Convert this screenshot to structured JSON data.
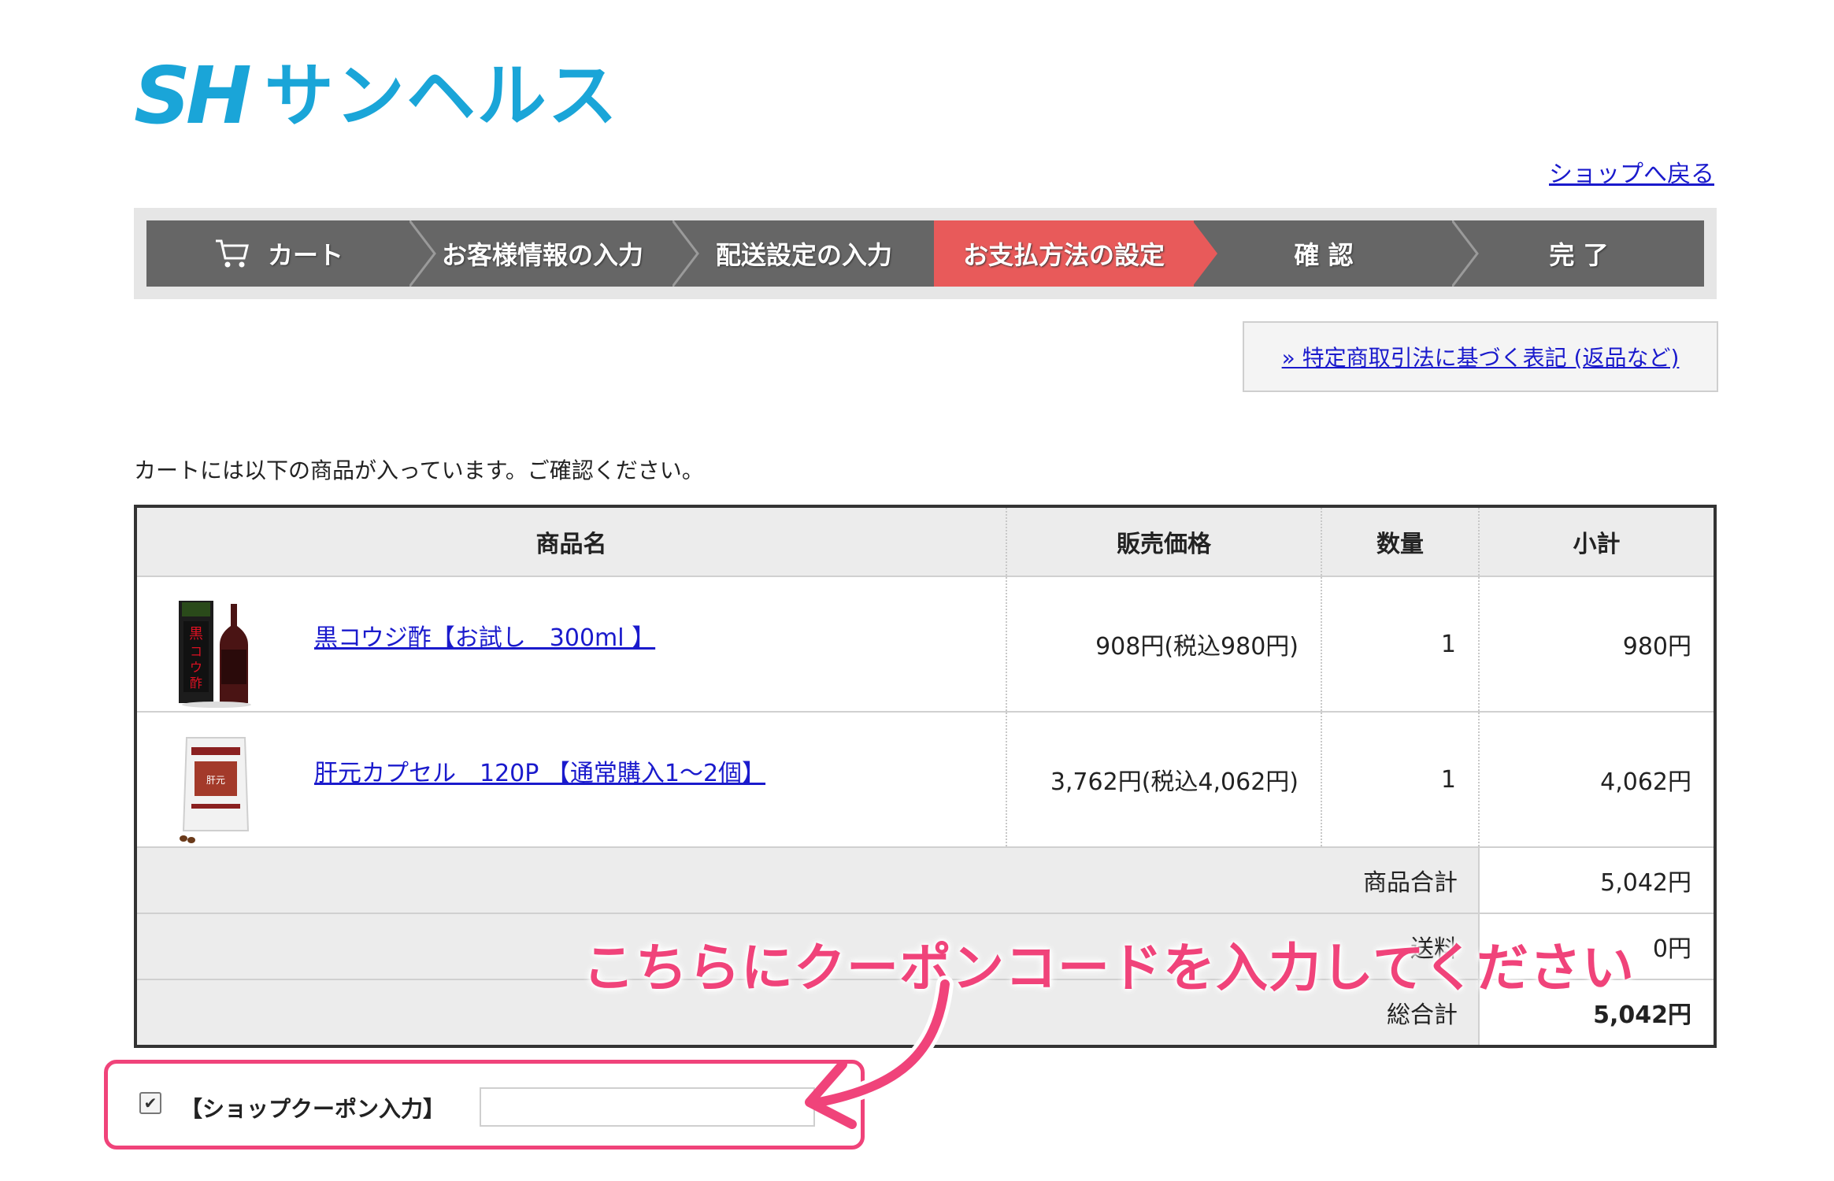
{
  "logo": {
    "mark": "SH",
    "name": "サンヘルス",
    "brand_color": "#1aa5d8"
  },
  "back_link": "ショップへ戻る",
  "steps": [
    {
      "label": "カート",
      "active": false
    },
    {
      "label": "お客様情報の入力",
      "active": false
    },
    {
      "label": "配送設定の入力",
      "active": false
    },
    {
      "label": "お支払方法の設定",
      "active": true
    },
    {
      "label": "確 認",
      "active": false
    },
    {
      "label": "完 了",
      "active": false
    }
  ],
  "law_link": "» 特定商取引法に基づく表記 (返品など)",
  "intro": "カートには以下の商品が入っています。ご確認ください。",
  "table": {
    "headers": [
      "商品名",
      "販売価格",
      "数量",
      "小計"
    ],
    "rows": [
      {
        "name": "黒コウジ酢【お試し　300ml 】",
        "price": "908円(税込980円)",
        "qty": "1",
        "subtotal": "980円"
      },
      {
        "name": "肝元カプセル　120P 【通常購入1～2個】",
        "price": "3,762円(税込4,062円)",
        "qty": "1",
        "subtotal": "4,062円"
      }
    ],
    "summary": [
      {
        "label": "商品合計",
        "value": "5,042円"
      },
      {
        "label": "送料",
        "value": "0円"
      },
      {
        "label": "総合計",
        "value": "5,042円"
      }
    ]
  },
  "coupon": {
    "checked": true,
    "label": "【ショップクーポン入力】",
    "value": ""
  },
  "annotation": "こちらにクーポンコードを入力してください",
  "colors": {
    "step_active": "#e85a5a",
    "step": "#666666",
    "highlight": "#f0437a",
    "link": "#1a1acc"
  }
}
